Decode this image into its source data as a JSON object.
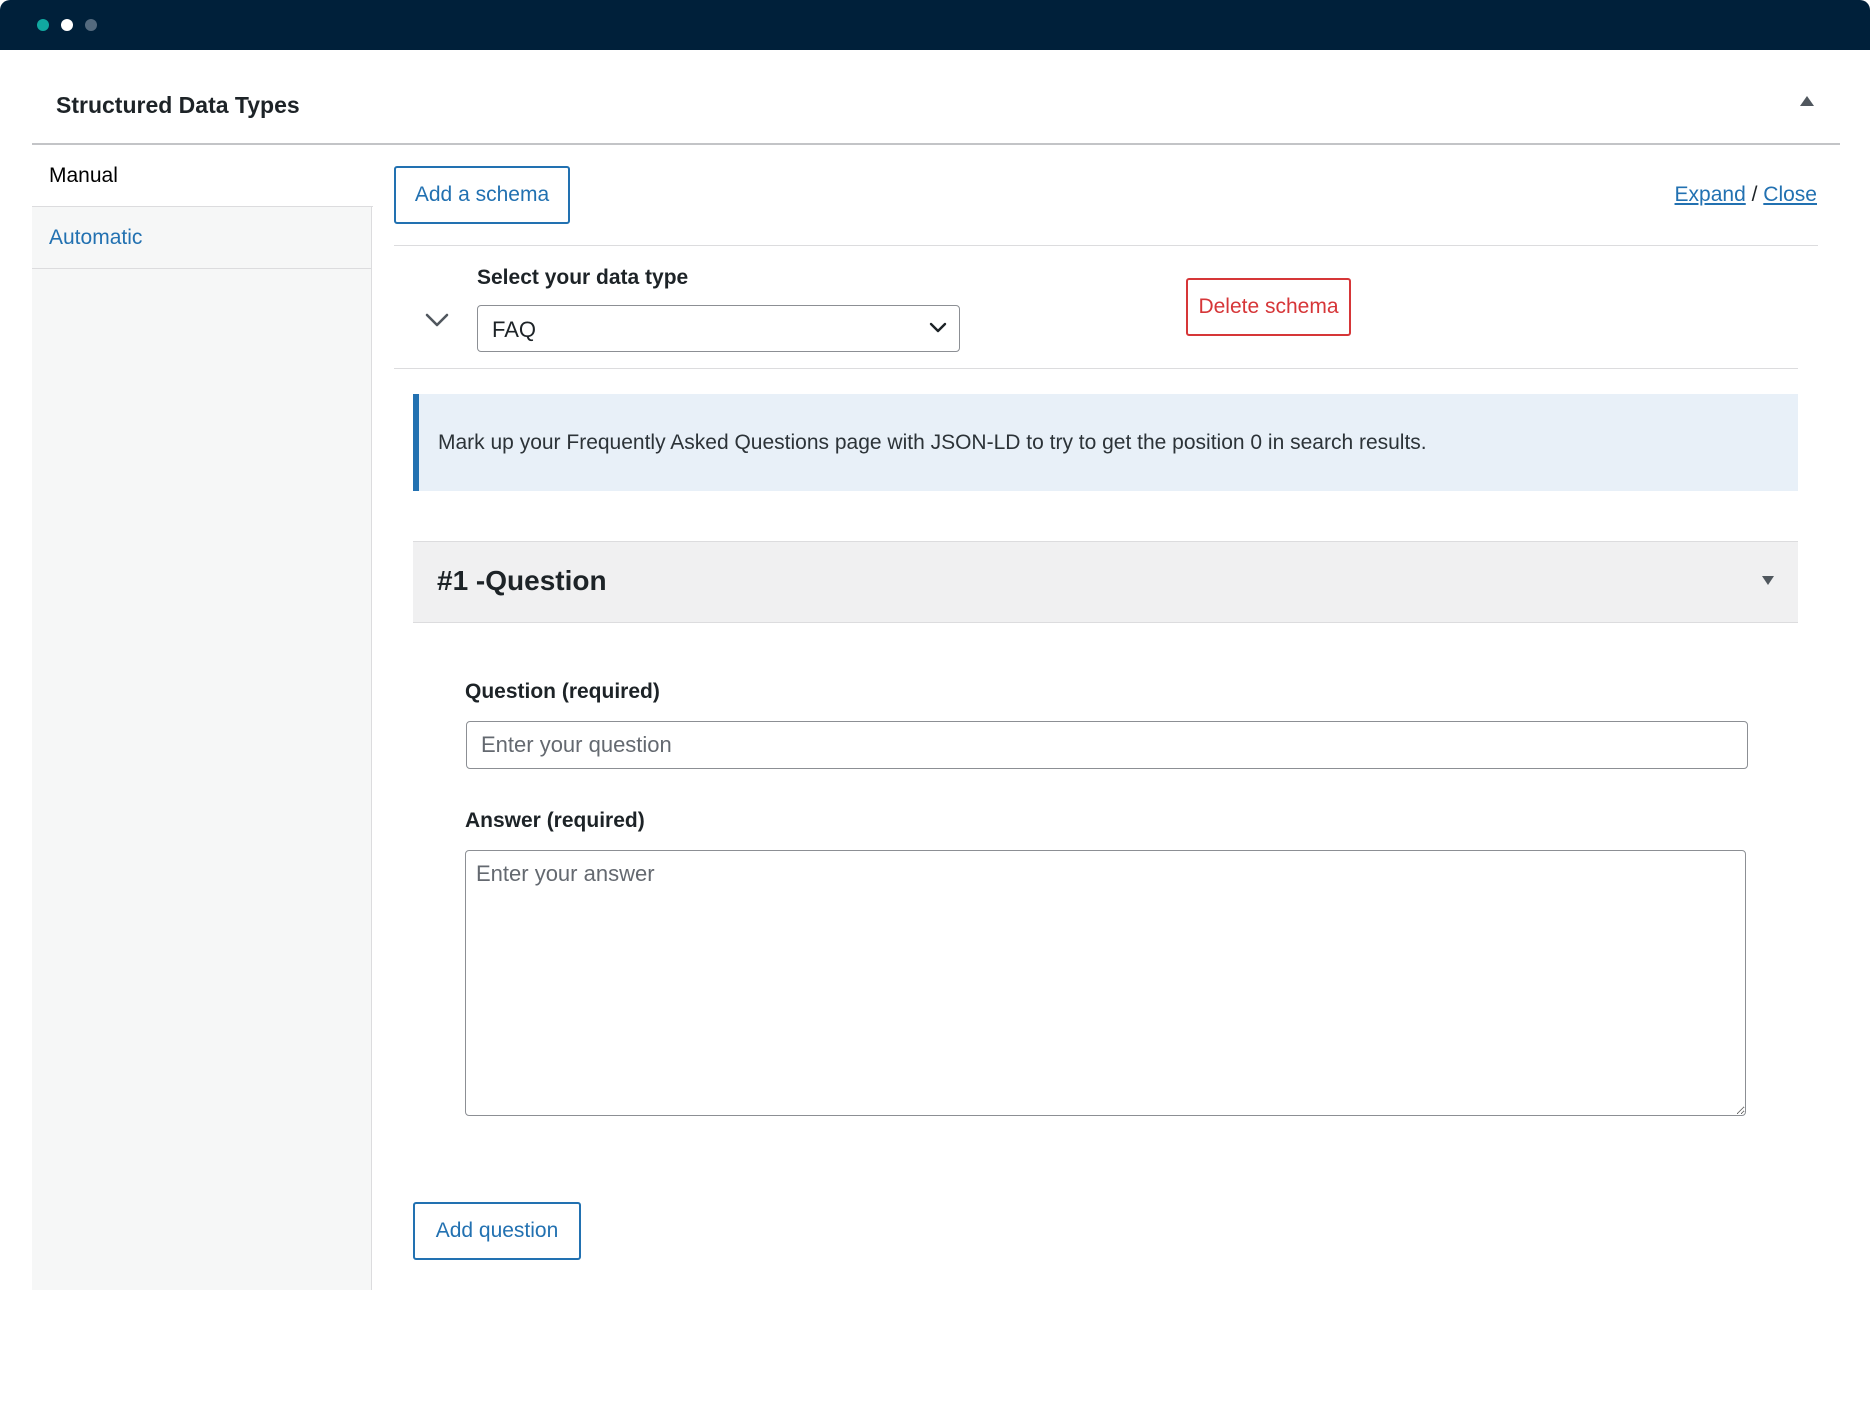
{
  "window": {
    "controls": [
      "close",
      "minimize",
      "maximize"
    ]
  },
  "metabox": {
    "title": "Structured Data Types"
  },
  "sidebar": {
    "tabs": [
      {
        "label": "Manual",
        "active": true
      },
      {
        "label": "Automatic",
        "active": false
      }
    ]
  },
  "toolbar": {
    "add_schema_label": "Add a schema",
    "expand_label": "Expand",
    "separator": "/",
    "close_label": "Close"
  },
  "schema": {
    "type_label": "Select your data type",
    "type_value": "FAQ",
    "delete_label": "Delete schema",
    "notice": "Mark up your Frequently Asked Questions page with JSON-LD to try to get the position 0 in search results."
  },
  "questions": [
    {
      "header": "#1 -Question",
      "question_label": "Question (required)",
      "question_placeholder": "Enter your question",
      "answer_label": "Answer (required)",
      "answer_placeholder": "Enter your answer"
    }
  ],
  "footer": {
    "add_question_label": "Add question"
  },
  "colors": {
    "titlebar": "#00203a",
    "accent": "#2271b1",
    "danger": "#d63638",
    "notice_bg": "#e8f0f8"
  }
}
